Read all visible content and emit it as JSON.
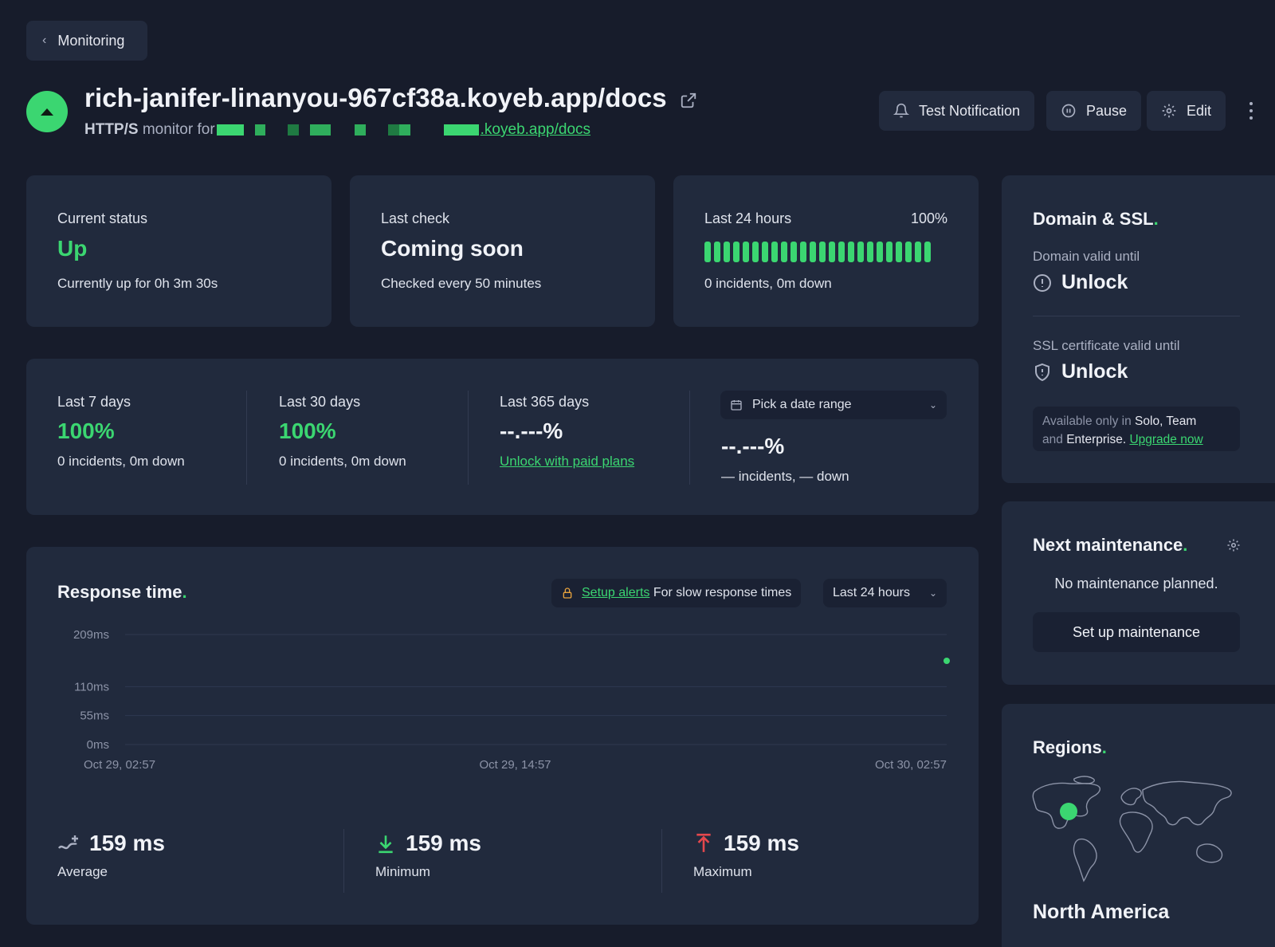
{
  "nav": {
    "back_label": "Monitoring"
  },
  "header": {
    "title": "rich-janifer-linanyou-967cf38a.koyeb.app/docs",
    "subtitle_type": "HTTP/S",
    "subtitle_text": "monitor for",
    "subtitle_link": ".koyeb.app/docs",
    "buttons": {
      "test_notification": "Test Notification",
      "pause": "Pause",
      "edit": "Edit"
    },
    "status_color": "#3bd671"
  },
  "current_status": {
    "label": "Current status",
    "value": "Up",
    "detail": "Currently up for 0h 3m 30s"
  },
  "last_check": {
    "label": "Last check",
    "value": "Coming soon",
    "detail": "Checked every 50 minutes"
  },
  "last_24h": {
    "label": "Last 24 hours",
    "percent": "100%",
    "detail": "0 incidents, 0m down",
    "bar_count": 24
  },
  "periods": [
    {
      "label": "Last 7 days",
      "value": "100%",
      "detail": "0 incidents, 0m down"
    },
    {
      "label": "Last 30 days",
      "value": "100%",
      "detail": "0 incidents, 0m down"
    },
    {
      "label": "Last 365 days",
      "value": "--.---%",
      "link": "Unlock with paid plans"
    }
  ],
  "custom_range": {
    "picker_label": "Pick a date range",
    "value": "--.---%",
    "detail": "— incidents, — down"
  },
  "response_time": {
    "title": "Response time",
    "alert_link": "Setup alerts",
    "alert_text": "For slow response times",
    "range_label": "Last 24 hours",
    "stats": [
      {
        "value": "159 ms",
        "label": "Average"
      },
      {
        "value": "159 ms",
        "label": "Minimum"
      },
      {
        "value": "159 ms",
        "label": "Maximum"
      }
    ]
  },
  "chart_data": {
    "type": "scatter",
    "title": "",
    "xlabel": "",
    "ylabel": "",
    "y_ticks": [
      "209ms",
      "110ms",
      "55ms",
      "0ms"
    ],
    "x_ticks": [
      "Oct 29, 02:57",
      "Oct 29, 14:57",
      "Oct 30, 02:57"
    ],
    "series": [
      {
        "x": [
          "Oct 30, 02:57"
        ],
        "values": [
          159
        ]
      }
    ],
    "ylim": [
      0,
      209
    ],
    "grid": true,
    "color": "#3bd671"
  },
  "domain_ssl": {
    "title": "Domain & SSL",
    "domain_label": "Domain valid until",
    "domain_value": "Unlock",
    "ssl_label": "SSL certificate valid until",
    "ssl_value": "Unlock",
    "upsell_prefix": "Available only in",
    "upsell_plans": "Solo, Team",
    "upsell_and": "and",
    "upsell_enterprise": "Enterprise.",
    "upsell_link": "Upgrade now"
  },
  "maintenance": {
    "title": "Next maintenance",
    "empty_text": "No maintenance planned.",
    "button": "Set up maintenance"
  },
  "regions": {
    "title": "Regions",
    "region": "North America"
  }
}
